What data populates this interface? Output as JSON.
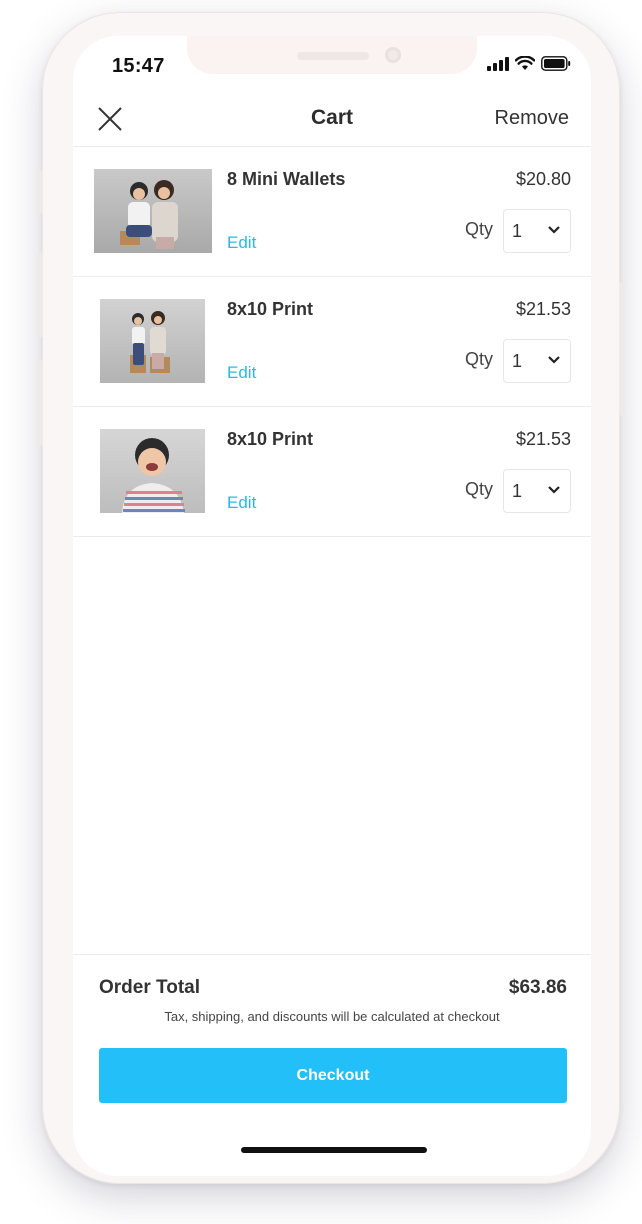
{
  "status_bar": {
    "time": "15:47"
  },
  "nav": {
    "title": "Cart",
    "remove_label": "Remove"
  },
  "items": [
    {
      "title": "8 Mini Wallets",
      "price": "$20.80",
      "edit_label": "Edit",
      "qty_label": "Qty",
      "qty_value": "1"
    },
    {
      "title": "8x10 Print",
      "price": "$21.53",
      "edit_label": "Edit",
      "qty_label": "Qty",
      "qty_value": "1"
    },
    {
      "title": "8x10 Print",
      "price": "$21.53",
      "edit_label": "Edit",
      "qty_label": "Qty",
      "qty_value": "1"
    }
  ],
  "footer": {
    "total_label": "Order Total",
    "total_value": "$63.86",
    "note": "Tax, shipping, and discounts will be calculated at checkout",
    "checkout_label": "Checkout"
  },
  "colors": {
    "accent": "#22bff8",
    "link": "#29b8ea",
    "text": "#333333"
  }
}
